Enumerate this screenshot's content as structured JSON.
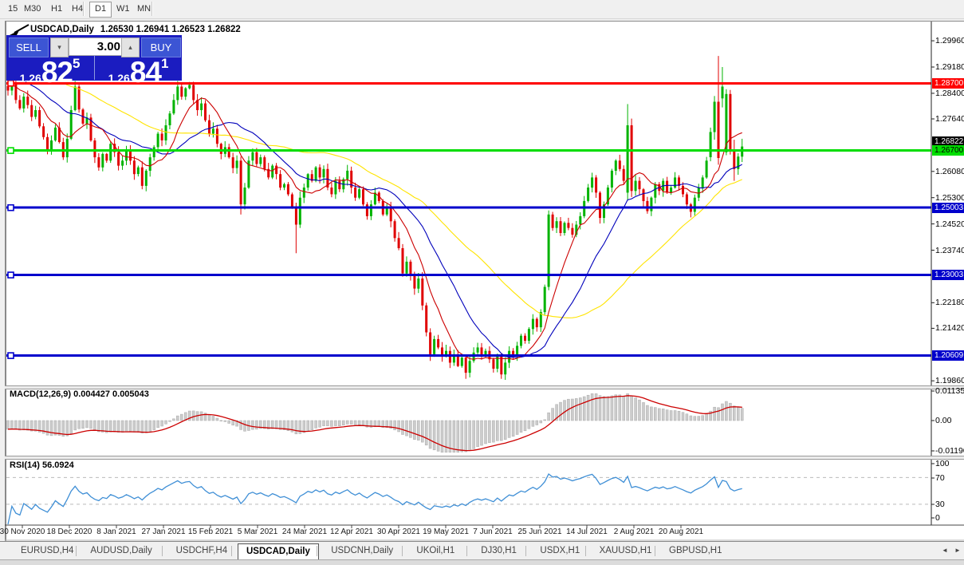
{
  "toolbar": {
    "timeframes": [
      "15",
      "M30",
      "H1",
      "H4",
      "D1",
      "W1",
      "MN"
    ],
    "active": "D1"
  },
  "chart": {
    "symbol_title": "USDCAD,Daily",
    "ohlc_text": "1.26530 1.26941 1.26523 1.26822",
    "current_price": "1.26822"
  },
  "trade_panel": {
    "sell_label": "SELL",
    "buy_label": "BUY",
    "volume": "3.00",
    "sell_small": "1.26",
    "sell_big": "82",
    "sell_sup": "5",
    "buy_small": "1.26",
    "buy_big": "84",
    "buy_sup": "1"
  },
  "icons": {
    "spin_down": "▾",
    "spin_up": "▴",
    "scroll_left": "◄",
    "scroll_right": "►"
  },
  "macd_panel": {
    "label": "MACD(12,26,9) 0.004427 0.005043",
    "scale": [
      "0.01135",
      "0.00",
      "-0.01190"
    ]
  },
  "rsi_panel": {
    "label": "RSI(14) 56.0924",
    "scale": [
      "100",
      "70",
      "30",
      "0"
    ],
    "levels": [
      70,
      30
    ]
  },
  "tabs": [
    "EURUSD,H4",
    "AUDUSD,Daily",
    "USDCHF,H4",
    "USDCAD,Daily",
    "USDCNH,Daily",
    "UKOil,H1",
    "DJ30,H1",
    "USDX,H1",
    "XAUUSD,H1",
    "GBPUSD,H1"
  ],
  "active_tab": "USDCAD,Daily",
  "colors": {
    "bull": "#00b300",
    "bear": "#e00000",
    "ma_fast": "#cc0000",
    "ma_mid": "#0000bb",
    "ma_slow": "#ffe400",
    "macd_hist_fill": "#cccccc",
    "macd_hist_stroke": "#aaaaaa",
    "macd_signal": "#cc0000",
    "rsi_line": "#3f8fd6",
    "level_dash": "#bbbbbb",
    "hline_red": "#ff0000",
    "hline_green": "#00dd00",
    "hline_blue": "#0000cc",
    "tag_black": "#000000"
  },
  "chart_data": {
    "type": "candlestick",
    "title": "USDCAD,Daily",
    "price_axis_ticks": [
      "1.29960",
      "1.29180",
      "1.28400",
      "1.27640",
      "1.26080",
      "1.25300",
      "1.24520",
      "1.23740",
      "1.22180",
      "1.21420",
      "1.19860"
    ],
    "date_labels": [
      "30 Nov 2020",
      "18 Dec 2020",
      "8 Jan 2021",
      "27 Jan 2021",
      "15 Feb 2021",
      "5 Mar 2021",
      "24 Mar 2021",
      "12 Apr 2021",
      "30 Apr 2021",
      "19 May 2021",
      "7 Jun 2021",
      "25 Jun 2021",
      "14 Jul 2021",
      "2 Aug 2021",
      "20 Aug 2021"
    ],
    "hlines": [
      {
        "price": 1.287,
        "label": "1.28700",
        "color": "#ff0000",
        "text": "#ffffff"
      },
      {
        "price": 1.267,
        "label": "1.26700",
        "color": "#00dd00",
        "text": "#000000"
      },
      {
        "price": 1.25003,
        "label": "1.25003",
        "color": "#0000cc",
        "text": "#ffffff"
      },
      {
        "price": 1.23003,
        "label": "1.23003",
        "color": "#0000cc",
        "text": "#ffffff"
      },
      {
        "price": 1.20609,
        "label": "1.20609",
        "color": "#0000cc",
        "text": "#ffffff"
      }
    ],
    "current_price": 1.26822,
    "closes": [
      1.2848,
      1.2872,
      1.282,
      1.2795,
      1.283,
      1.2805,
      1.277,
      1.279,
      1.2742,
      1.271,
      1.2672,
      1.27,
      1.2738,
      1.2695,
      1.265,
      1.2705,
      1.279,
      1.286,
      1.2792,
      1.275,
      1.2768,
      1.27,
      1.265,
      1.262,
      1.266,
      1.264,
      1.269,
      1.2665,
      1.2625,
      1.264,
      1.267,
      1.264,
      1.26,
      1.262,
      1.2565,
      1.261,
      1.265,
      1.268,
      1.272,
      1.27,
      1.2745,
      1.278,
      1.282,
      1.286,
      1.283,
      1.2855,
      1.2865,
      1.282,
      1.279,
      1.281,
      1.276,
      1.272,
      1.2735,
      1.269,
      1.266,
      1.268,
      1.265,
      1.2618,
      1.264,
      1.251,
      1.256,
      1.264,
      1.2665,
      1.263,
      1.265,
      1.2615,
      1.259,
      1.2625,
      1.26,
      1.256,
      1.257,
      1.254,
      1.25,
      1.245,
      1.253,
      1.256,
      1.26,
      1.258,
      1.262,
      1.259,
      1.2615,
      1.256,
      1.254,
      1.258,
      1.2555,
      1.2585,
      1.261,
      1.256,
      1.253,
      1.2555,
      1.251,
      1.2475,
      1.251,
      1.2545,
      1.252,
      1.248,
      1.25,
      1.246,
      1.241,
      1.238,
      1.2305,
      1.234,
      1.23,
      1.226,
      1.229,
      1.221,
      1.213,
      1.2065,
      1.211,
      1.2085,
      1.206,
      1.2075,
      1.204,
      1.2065,
      1.203,
      1.2055,
      1.201,
      1.2045,
      1.207,
      1.2085,
      1.206,
      1.2075,
      1.205,
      1.2022,
      1.206,
      1.2005,
      1.204,
      1.2075,
      1.206,
      1.209,
      1.212,
      1.2105,
      1.214,
      1.217,
      1.2145,
      1.219,
      1.2265,
      1.248,
      1.244,
      1.246,
      1.2425,
      1.2455,
      1.244,
      1.242,
      1.245,
      1.2475,
      1.252,
      1.256,
      1.259,
      1.2545,
      1.247,
      1.251,
      1.256,
      1.261,
      1.264,
      1.2615,
      1.258,
      1.2745,
      1.255,
      1.258,
      1.2555,
      1.252,
      1.249,
      1.253,
      1.257,
      1.255,
      1.258,
      1.2545,
      1.256,
      1.259,
      1.2565,
      1.254,
      1.251,
      1.2488,
      1.253,
      1.256,
      1.259,
      1.264,
      1.2725,
      1.2815,
      1.2648,
      1.286,
      1.2838,
      1.2672,
      1.2615,
      1.2652,
      1.2682
    ],
    "explicit_ohlc": {
      "59": [
        1.264,
        1.2652,
        1.248,
        1.251
      ],
      "73": [
        1.25,
        1.2515,
        1.2365,
        1.245
      ],
      "100": [
        1.238,
        1.2392,
        1.2295,
        1.2305
      ],
      "106": [
        1.221,
        1.2218,
        1.2118,
        1.213
      ],
      "107": [
        1.213,
        1.2142,
        1.2045,
        1.2065
      ],
      "116": [
        1.2055,
        1.2062,
        1.1992,
        1.201
      ],
      "125": [
        1.206,
        1.2068,
        1.1992,
        1.2005
      ],
      "136": [
        1.219,
        1.2272,
        1.2182,
        1.2265
      ],
      "137": [
        1.2265,
        1.2492,
        1.2255,
        1.248
      ],
      "157": [
        1.2545,
        1.2808,
        1.2522,
        1.2745
      ],
      "158": [
        1.2745,
        1.2765,
        1.2532,
        1.255
      ],
      "178": [
        1.265,
        1.2738,
        1.2638,
        1.2725
      ],
      "179": [
        1.2725,
        1.2832,
        1.2702,
        1.2815
      ],
      "180": [
        1.2815,
        1.2951,
        1.2628,
        1.2648
      ],
      "181": [
        1.2825,
        1.2918,
        1.2798,
        1.286
      ],
      "182": [
        1.2665,
        1.2852,
        1.2656,
        1.2838
      ],
      "183": [
        1.2838,
        1.285,
        1.2658,
        1.2672
      ],
      "184": [
        1.2672,
        1.2702,
        1.258,
        1.2615
      ],
      "185": [
        1.2615,
        1.2662,
        1.2598,
        1.2652
      ],
      "186": [
        1.2652,
        1.2705,
        1.2636,
        1.2682
      ]
    },
    "indicators": [
      {
        "name": "MACD",
        "params": "12,26,9",
        "values": [
          0.004427,
          0.005043
        ]
      },
      {
        "name": "RSI",
        "params": "14",
        "values": [
          56.0924
        ]
      }
    ]
  }
}
